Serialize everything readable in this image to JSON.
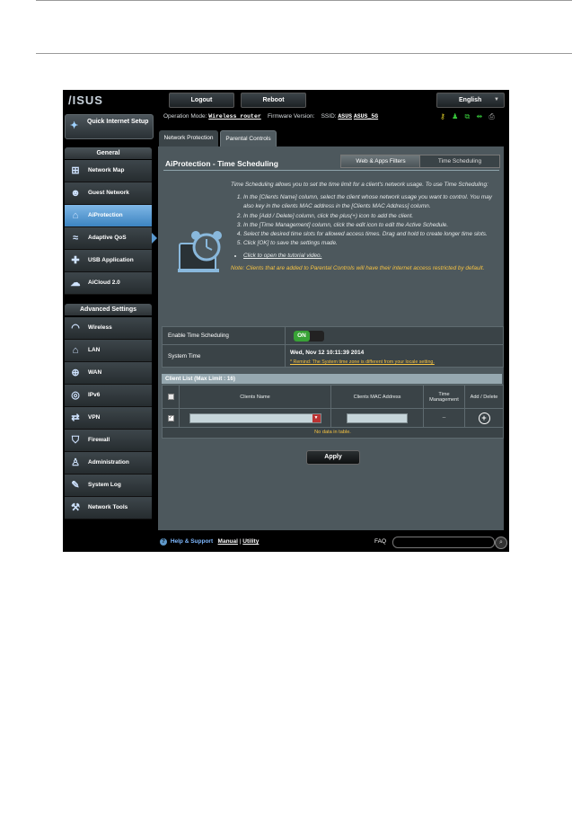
{
  "brand": {
    "logo_text": "/ISUS"
  },
  "topbar": {
    "logout": "Logout",
    "reboot": "Reboot",
    "language": "English"
  },
  "header": {
    "operation_mode_label": "Operation Mode:",
    "operation_mode_value": "Wireless router",
    "firmware_label": "Firmware Version:",
    "ssid_label": "SSID:",
    "ssid_values": [
      "ASUS",
      "ASUS_5G"
    ]
  },
  "sidebar": {
    "quick_setup": "Quick Internet Setup",
    "general_header": "General",
    "general_items": [
      {
        "label": "Network Map",
        "icon": "network-map-icon"
      },
      {
        "label": "Guest Network",
        "icon": "guest-network-icon"
      },
      {
        "label": "AiProtection",
        "icon": "aiprotection-icon",
        "active": true
      },
      {
        "label": "Adaptive QoS",
        "icon": "qos-icon"
      },
      {
        "label": "USB Application",
        "icon": "usb-application-icon"
      },
      {
        "label": "AiCloud 2.0",
        "icon": "aicloud-icon"
      }
    ],
    "advanced_header": "Advanced Settings",
    "advanced_items": [
      {
        "label": "Wireless",
        "icon": "wireless-icon"
      },
      {
        "label": "LAN",
        "icon": "lan-icon"
      },
      {
        "label": "WAN",
        "icon": "wan-icon"
      },
      {
        "label": "IPv6",
        "icon": "ipv6-icon"
      },
      {
        "label": "VPN",
        "icon": "vpn-icon"
      },
      {
        "label": "Firewall",
        "icon": "firewall-icon"
      },
      {
        "label": "Administration",
        "icon": "administration-icon"
      },
      {
        "label": "System Log",
        "icon": "system-log-icon"
      },
      {
        "label": "Network Tools",
        "icon": "network-tools-icon"
      }
    ]
  },
  "tabs": [
    "Network Protection",
    "Parental Controls"
  ],
  "main": {
    "title": "AiProtection - Time Scheduling",
    "segments": [
      "Web & Apps Filters",
      "Time Scheduling"
    ],
    "intro": "Time Scheduling allows you to set the time limit for a client's network usage. To use Time Scheduling:",
    "steps": [
      "In the [Clients Name] column, select the client whose network usage you want to control. You may also key in the clients MAC address in the [Clients MAC Address] column.",
      "In the [Add / Delete] column, click the plus(+) icon to add the client.",
      "In the [Time Management] column, click the edit icon to edit the Active Schedule.",
      "Select the desired time slots for allowed access times. Drag and hold to create longer time slots.",
      "Click [OK] to save the settings made."
    ],
    "tutorial_link": "Click to open the tutorial video.",
    "note": "Note: Clients that are added to Parental Controls will have their internet access restricted by default.",
    "enable_label": "Enable Time Scheduling",
    "toggle_state": "ON",
    "system_time_label": "System Time",
    "system_time_value": "Wed, Nov 12 10:11:39 2014",
    "remind": "* Remind: The System time zone is different from your locale setting.",
    "client_list_title": "Client List (Max Limit : 16)",
    "columns": [
      "Clients Name",
      "Clients MAC Address",
      "Time Management",
      "Add / Delete"
    ],
    "time_mgmt_placeholder": "--",
    "no_data": "No data in table.",
    "apply": "Apply"
  },
  "footer": {
    "help": "Help & Support",
    "manual": "Manual",
    "separator": "|",
    "utility": "Utility",
    "faq": "FAQ"
  },
  "colors": {
    "accent_blue": "#4a8fcf",
    "toggle_green": "#38a236",
    "note_yellow": "#f5c242"
  }
}
